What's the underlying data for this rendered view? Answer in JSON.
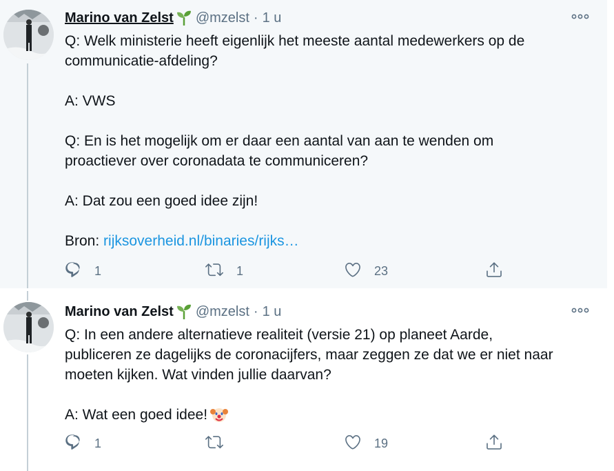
{
  "tweets": [
    {
      "name": "Marino van Zelst",
      "handle": "@mzelst",
      "separator": "·",
      "time": "1 u",
      "lines": [
        "Q: Welk ministerie heeft eigenlijk het meeste aantal medewerkers op de",
        "communicatie-afdeling?",
        "A: VWS",
        "Q: En is het mogelijk om er daar een aantal van aan te wenden om",
        "proactiever over coronadata te communiceren?",
        "A: Dat zou een goed idee zijn!"
      ],
      "source_label": "Bron:",
      "link_text": "rijksoverheid.nl/binaries/rijks…",
      "reply_count": "1",
      "retweet_count": "1",
      "like_count": "23",
      "icons": {
        "more": "more-icon",
        "reply": "reply-icon",
        "retweet": "retweet-icon",
        "like": "like-icon",
        "share": "share-icon",
        "badge": "sprout-emoji"
      }
    },
    {
      "name": "Marino van Zelst",
      "handle": "@mzelst",
      "separator": "·",
      "time": "1 u",
      "lines": [
        "Q: In een andere alternatieve realiteit (versie 21) op planeet Aarde,",
        "publiceren ze dagelijks de coronacijfers, maar zeggen ze dat we er niet naar",
        "moeten kijken. Wat vinden jullie daarvan?",
        "A: Wat een goed idee!"
      ],
      "reply_count": "1",
      "retweet_count": "",
      "like_count": "19",
      "icons": {
        "more": "more-icon",
        "reply": "reply-icon",
        "retweet": "retweet-icon",
        "like": "like-icon",
        "share": "share-icon",
        "badge": "sprout-emoji",
        "clown": "clown-emoji"
      }
    }
  ],
  "colors": {
    "text": "#0f1419",
    "secondary": "#5b7083",
    "link": "#1b95e0",
    "highlight_bg": "#f5f8fa",
    "thread_line": "#c4cfd6"
  }
}
